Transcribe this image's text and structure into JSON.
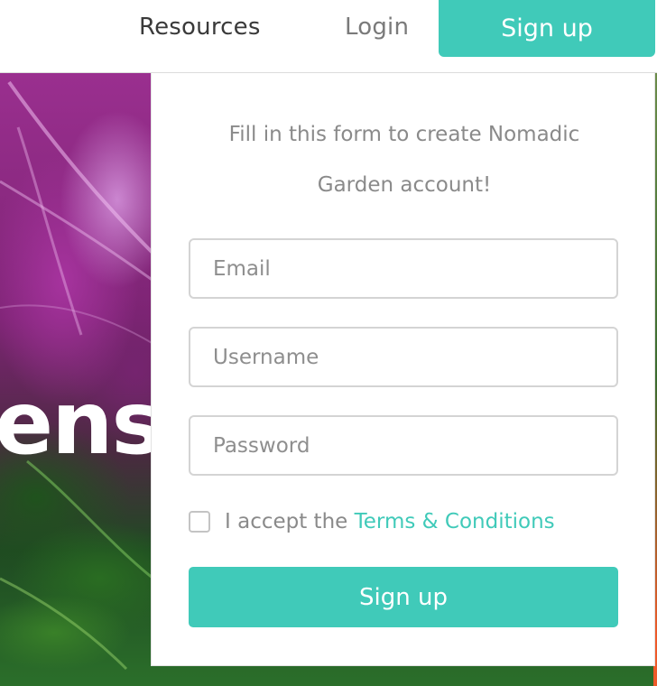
{
  "nav": {
    "resources": "Resources",
    "login": "Login",
    "signup": "Sign up"
  },
  "hero": {
    "text": "ens"
  },
  "form": {
    "intro_line1": "Fill in this form to create Nomadic",
    "intro_line2": "Garden account!",
    "email_placeholder": "Email",
    "username_placeholder": "Username",
    "password_placeholder": "Password",
    "terms_prefix": "I accept the ",
    "terms_link": "Terms & Conditions",
    "terms_checked": false,
    "submit": "Sign up"
  },
  "colors": {
    "accent": "#40cab9",
    "muted_text": "#8a8a8a",
    "border": "#d4d4d4"
  }
}
